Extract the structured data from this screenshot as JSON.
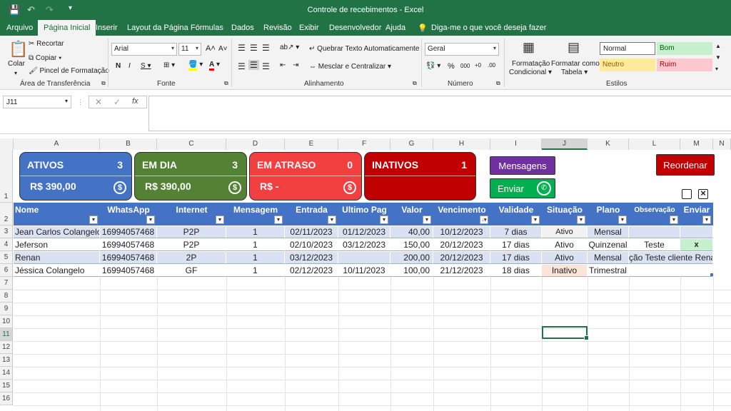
{
  "window": {
    "title": "Controle de recebimentos  -  Excel"
  },
  "tabs": [
    "Arquivo",
    "Página Inicial",
    "Inserir",
    "Layout da Página",
    "Fórmulas",
    "Dados",
    "Revisão",
    "Exibir",
    "Desenvolvedor",
    "Ajuda"
  ],
  "tell_me": "Diga-me o que você deseja fazer",
  "ribbon": {
    "colar": "Colar",
    "recortar": "Recortar",
    "copiar": "Copiar",
    "pincel": "Pincel de Formatação",
    "font_name": "Arial",
    "font_size": "11",
    "wrap": "Quebrar Texto Automaticamente",
    "merge": "Mesclar e Centralizar",
    "num_format": "Geral",
    "cond_fmt_1": "Formatação",
    "cond_fmt_2": "Condicional",
    "fmt_table_1": "Formatar como",
    "fmt_table_2": "Tabela",
    "styles": {
      "normal": "Normal",
      "bom": "Bom",
      "neutro": "Neutro",
      "ruim": "Ruim"
    },
    "groups": {
      "clipboard": "Área de Transferência",
      "font": "Fonte",
      "align": "Alinhamento",
      "number": "Número",
      "styles": "Estilos"
    }
  },
  "name_box": "J11",
  "columns": [
    "A",
    "B",
    "C",
    "D",
    "E",
    "F",
    "G",
    "H",
    "I",
    "J",
    "K",
    "L",
    "M",
    "N"
  ],
  "rows": [
    "1",
    "2",
    "3",
    "4",
    "5",
    "6",
    "7",
    "8",
    "9",
    "10",
    "11",
    "12",
    "13",
    "14",
    "15",
    "16"
  ],
  "cards": [
    {
      "label": "ATIVOS",
      "count": "3",
      "amount": "R$ 390,00",
      "color": "#4472c4"
    },
    {
      "label": "EM DIA",
      "count": "3",
      "amount": "R$ 390,00",
      "color": "#548235"
    },
    {
      "label": "EM ATRASO",
      "count": "0",
      "amount": "R$ -",
      "color": "#f23f3f"
    },
    {
      "label": "INATIVOS",
      "count": "1",
      "amount": "",
      "color": "#c00000"
    }
  ],
  "buttons": {
    "mensagens": "Mensagens",
    "enviar": "Enviar",
    "reordenar": "Reordenar",
    "close_x": "×"
  },
  "table": {
    "headers": [
      "Nome",
      "WhatsApp",
      "Internet",
      "Mensagem",
      "Entrada",
      "Ultimo Pag",
      "Valor",
      "Vencimento",
      "Validade",
      "Situação",
      "Plano",
      "Observação",
      "Enviar"
    ],
    "rows": [
      [
        "Jean Carlos Colangelo",
        "16994057468",
        "P2P",
        "1",
        "02/11/2023",
        "01/12/2023",
        "40,00",
        "10/12/2023",
        "7 dias",
        "Ativo",
        "Mensal",
        "",
        ""
      ],
      [
        "Jeferson",
        "16994057468",
        "P2P",
        "1",
        "02/10/2023",
        "03/12/2023",
        "150,00",
        "20/12/2023",
        "17 dias",
        "Ativo",
        "Quinzenal",
        "Teste",
        "x"
      ],
      [
        "Renan",
        "16994057468",
        "2P",
        "1",
        "03/12/2023",
        "",
        "200,00",
        "20/12/2023",
        "17 dias",
        "Ativo",
        "Mensal",
        "ção Teste cliente Renan",
        ""
      ],
      [
        "Jéssica Colangelo",
        "16994057468",
        "GF",
        "1",
        "02/12/2023",
        "10/11/2023",
        "100,00",
        "21/12/2023",
        "18 dias",
        "Inativo",
        "Trimestral",
        "",
        ""
      ]
    ]
  }
}
